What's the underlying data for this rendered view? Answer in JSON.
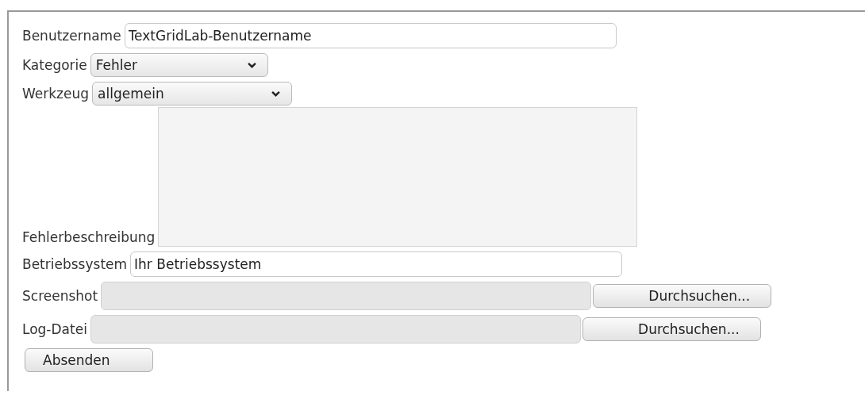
{
  "form": {
    "fields": [
      {
        "kind": "text",
        "label": "Benutzername",
        "value": "TextGridLab-Benutzername"
      },
      {
        "kind": "select",
        "label": "Kategorie",
        "value": "Fehler"
      },
      {
        "kind": "select",
        "label": "Werkzeug",
        "value": "allgemein"
      },
      {
        "kind": "textarea",
        "label": "Fehlerbeschreibung"
      },
      {
        "kind": "text",
        "label": "Betriebssystem",
        "value": "Ihr Betriebssystem"
      },
      {
        "kind": "file",
        "label": "Screenshot",
        "button": "Durchsuchen..."
      },
      {
        "kind": "file",
        "label": "Log-Datei",
        "button": "Durchsuchen..."
      }
    ],
    "submit": "Absenden"
  }
}
